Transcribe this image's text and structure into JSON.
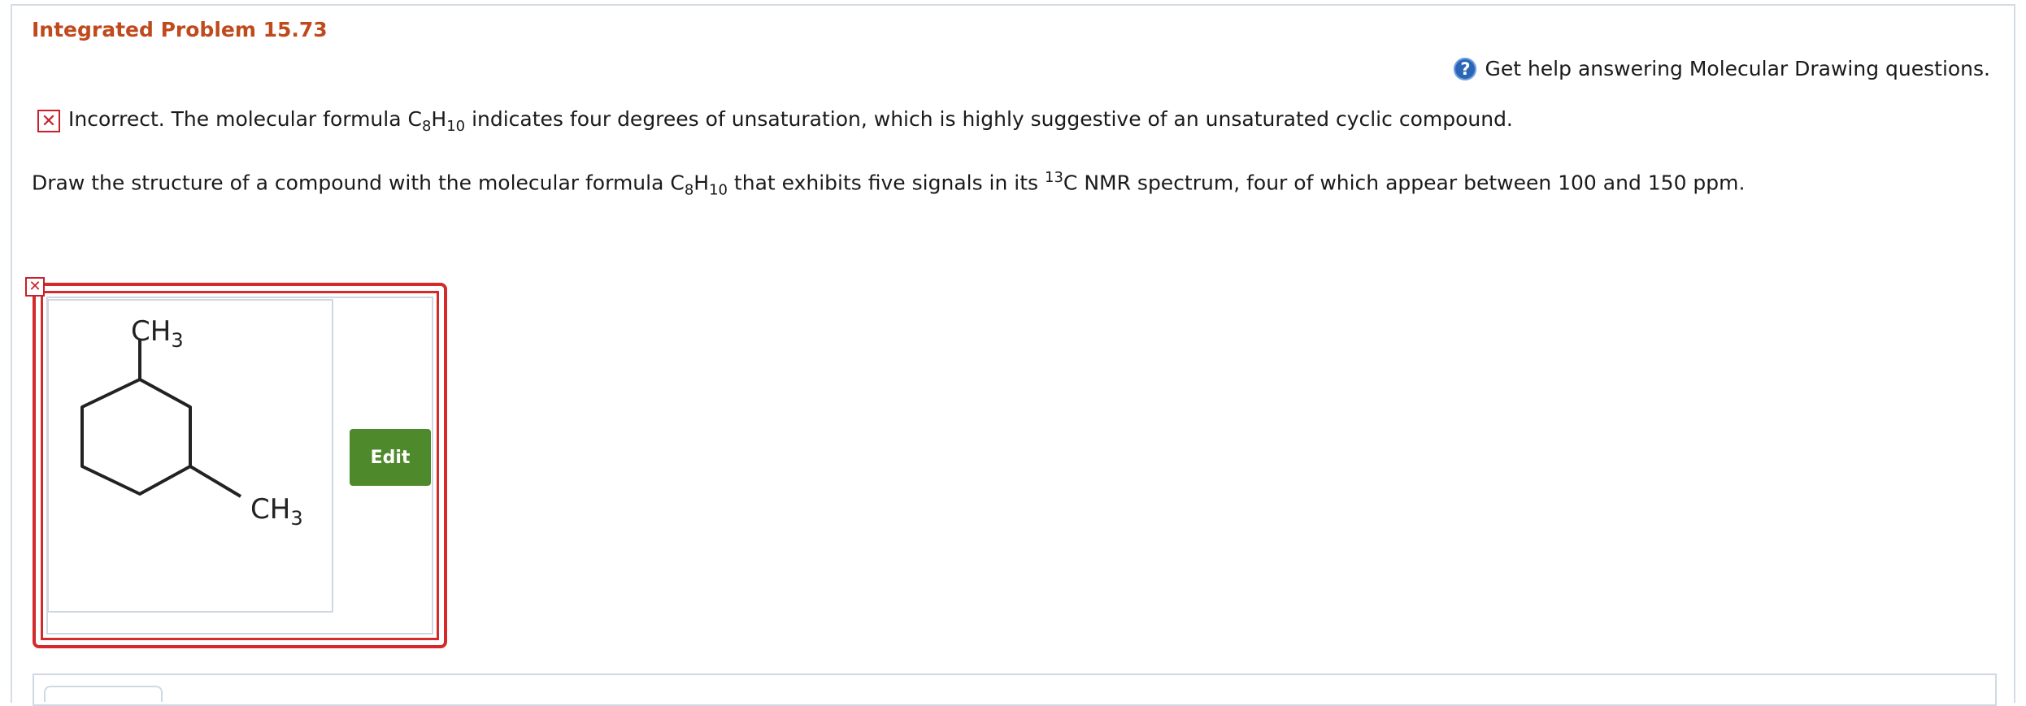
{
  "header": {
    "title": "Integrated Problem 15.73"
  },
  "help": {
    "icon": "question-circle-icon",
    "text": "Get help answering Molecular Drawing questions."
  },
  "feedback": {
    "icon": "x-icon",
    "prefix": "Incorrect. The molecular formula C",
    "sub1": "8",
    "mid": "H",
    "sub2": "10",
    "suffix": " indicates four degrees of unsaturation, which is highly suggestive of an unsaturated cyclic compound."
  },
  "question": {
    "prefix": "Draw the structure of a compound with the molecular formula C",
    "sub1": "8",
    "mid": "H",
    "sub2": "10",
    "middle": " that exhibits five signals in its ",
    "sup": "13",
    "suffix": "C NMR spectrum, four of which appear between 100 and 150 ppm."
  },
  "answer": {
    "status_icon": "x-icon",
    "structure": {
      "label_top": "CH",
      "label_top_sub": "3",
      "label_bottom": "CH",
      "label_bottom_sub": "3"
    },
    "edit_label": "Edit"
  },
  "colors": {
    "title": "#bf4a1e",
    "error": "#c8202b",
    "edit_button": "#4e8a2b",
    "help_icon": "#2a66b8"
  }
}
